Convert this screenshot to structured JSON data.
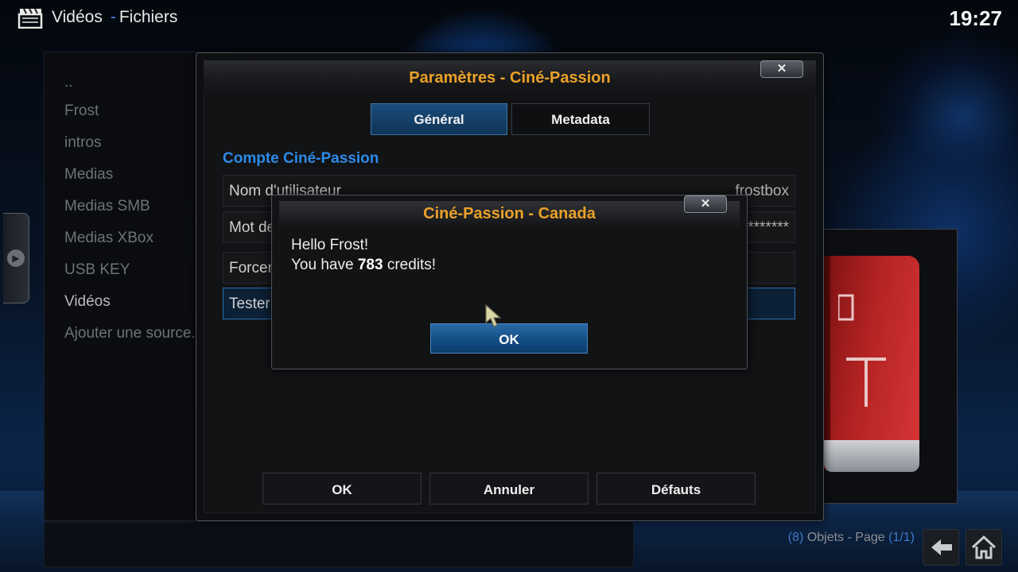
{
  "header": {
    "section": "Vidéos",
    "separator": "-",
    "subsection": "Fichiers",
    "clock": "19:27",
    "icon": "clapperboard-icon"
  },
  "sources": {
    "items": [
      "..",
      "Frost",
      "intros",
      "Medias",
      "Medias SMB",
      "Medias XBox",
      "USB KEY",
      "Vidéos",
      "Ajouter une source..."
    ]
  },
  "status": {
    "count_open": "(",
    "count": "8",
    "count_close": ")",
    "objects_label": "Objets - Page",
    "page_open": "(",
    "page": "1/1",
    "page_close": ")"
  },
  "settings_dialog": {
    "title": "Paramètres - Ciné-Passion",
    "close": "✕",
    "tabs": [
      {
        "label": "Général",
        "active": true
      },
      {
        "label": "Metadata",
        "active": false
      }
    ],
    "section_title": "Compte Ciné-Passion",
    "rows": [
      {
        "label": "Nom d'utilisateur",
        "value": "frostbox"
      },
      {
        "label": "Mot de passe",
        "value": "********"
      },
      {
        "label": "Forcer",
        "value": ""
      },
      {
        "label": "Tester",
        "value": ""
      }
    ],
    "buttons": {
      "ok": "OK",
      "cancel": "Annuler",
      "defaults": "Défauts"
    }
  },
  "popup": {
    "title": "Ciné-Passion - Canada",
    "close": "✕",
    "line1": "Hello Frost!",
    "line2_prefix": "You have",
    "credits": "783",
    "line2_suffix": "credits!",
    "ok": "OK"
  },
  "colors": {
    "accent_orange": "#eba128",
    "accent_blue": "#2d8be8"
  }
}
